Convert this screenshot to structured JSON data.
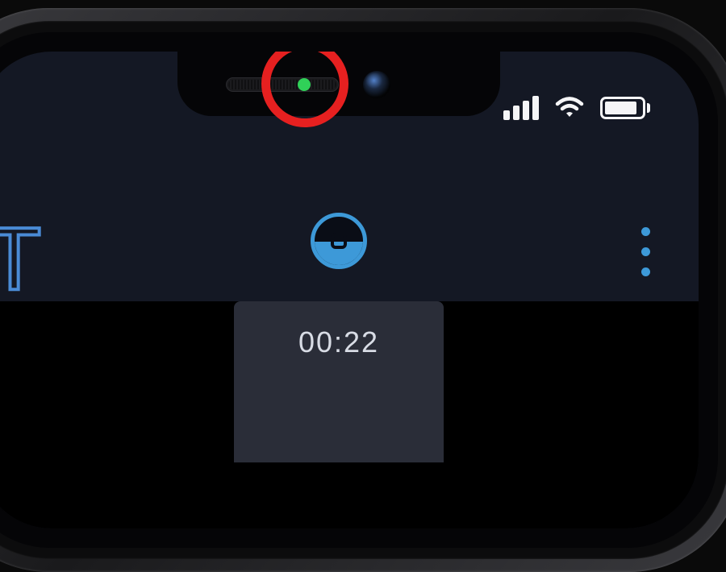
{
  "status": {
    "privacy_indicator_color": "#30d158",
    "cellular_bars": 4,
    "battery_percent": 88
  },
  "app": {
    "partial_title_glyph": "T",
    "recording_timer": "00:22"
  },
  "annotation": {
    "highlight_color": "#e62020"
  },
  "icons": {
    "cellular": "cellular-signal-icon",
    "wifi": "wifi-icon",
    "battery": "battery-icon",
    "privacy_dot": "camera-in-use-indicator",
    "menu": "more-options-icon"
  }
}
